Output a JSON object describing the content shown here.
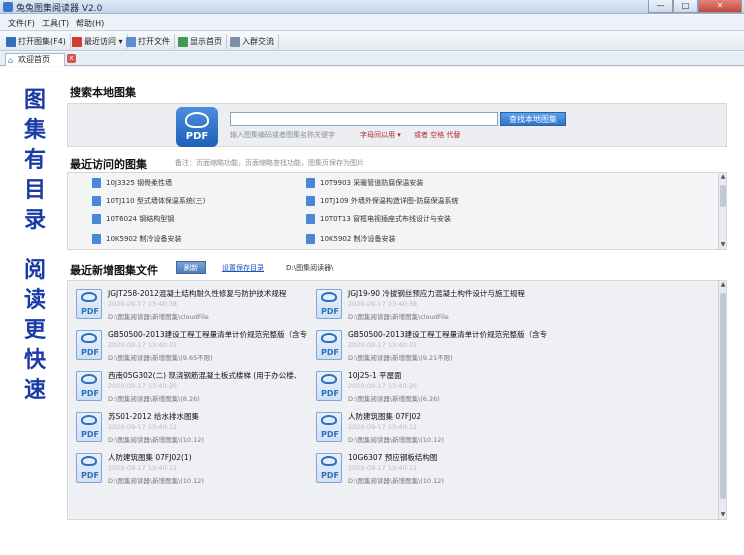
{
  "window": {
    "title": "兔兔图集阅读器 V2.0",
    "min_glyph": "—",
    "max_glyph": "□",
    "close_glyph": "✕"
  },
  "menu": [
    {
      "label": "文件(F)"
    },
    {
      "label": "工具(T)"
    },
    {
      "label": "帮助(H)"
    }
  ],
  "toolbar": {
    "open_atlas": "打开图集(F4)",
    "recent": "最近访问 ▾",
    "open_file": "打开文件",
    "show_home": "显示首页",
    "join_group": "入群交流"
  },
  "tab": {
    "label": "欢迎首页",
    "close_glyph": "x"
  },
  "slogan": [
    "图",
    "集",
    "有",
    "目",
    "录",
    "阅",
    "读",
    "更",
    "快",
    "速"
  ],
  "search": {
    "title": "搜索本地图集",
    "logo_text": "PDF",
    "input_value": "",
    "button_label": "查找本地图集",
    "hint": "输入图集编码或者图集名称关键字",
    "filter_label": "字母间以用 ▾",
    "tips": "或者 空格 代替"
  },
  "recent": {
    "title": "最近访问的图集",
    "hint": "备注：页面缩略功能，页面缩略查找功能，图集页保存为图片",
    "items": [
      {
        "label": "10J3325 钢骨柔性墙"
      },
      {
        "label": "10T9903 采暖管道防腐保温安装"
      },
      {
        "label": "10TJ110 型式墙体保温系统(三)"
      },
      {
        "label": "10TJ109 外墙外保温构造详图-防腐保温系统"
      },
      {
        "label": "10T6024 钢结构型钢"
      },
      {
        "label": "10T0T13 窗框电视插座式布线设计与安装"
      },
      {
        "label": "10K5902 制冷设备安装"
      },
      {
        "label": "10K5902 制冷设备安装"
      }
    ]
  },
  "new_files": {
    "title": "最近新增图集文件",
    "refresh_label": "刷新",
    "save_link": "设置保存目录",
    "save_path": "D:\\图集阅读器\\",
    "items": [
      {
        "title": "JGJT258-2012混凝土结构耐久性修复与防护技术规程",
        "meta": "2020-09-17 13:40:38",
        "path": "D:\\图集阅读器\\新增图集\\cloudFile"
      },
      {
        "title": "JGJ19-90 冷拔钢丝预应力混凝土构件设计与施工规程",
        "meta": "2020-09-17 13:40:38",
        "path": "D:\\图集阅读器\\新增图集\\cloudFile"
      },
      {
        "title": "GB50500-2013建设工程工程量清单计价规范完整版（含专",
        "meta": "2020-09-17 13:40:31",
        "path": "D:\\图集阅读器\\新增图集\\(9.65不限)"
      },
      {
        "title": "GB50500-2013建设工程工程量清单计价规范完整版（含专",
        "meta": "2020-09-17 13:40:31",
        "path": "D:\\图集阅读器\\新增图集\\(9.21不限)"
      },
      {
        "title": "西南05G302(二) 现浇钢筋混凝土板式楼梯 (用于办公楼、",
        "meta": "2020-09-17 13:40:26",
        "path": "D:\\图集阅读器\\新增图集\\(8.26)"
      },
      {
        "title": "10J25-1 平屋面",
        "meta": "2020-09-17 13:40:26",
        "path": "D:\\图集阅读器\\新增图集\\(6.26)"
      },
      {
        "title": "苏S01-2012 给水排水图集",
        "meta": "2020-09-17 13:40:12",
        "path": "D:\\图集阅读器\\新增图集\\(10.12)"
      },
      {
        "title": "人防建筑图集 07FJ02",
        "meta": "2020-09-17 13:40:12",
        "path": "D:\\图集阅读器\\新增图集\\(10.12)"
      },
      {
        "title": "人防建筑图集 07FJ02(1)",
        "meta": "2020-09-17 13:40:12",
        "path": "D:\\图集阅读器\\新增图集\\(10.12)"
      },
      {
        "title": "10G6307 预应钢板结构图",
        "meta": "2020-09-17 13:40:12",
        "path": "D:\\图集阅读器\\新增图集\\(10.12)"
      }
    ]
  },
  "scroll": {
    "up": "▲",
    "down": "▼"
  }
}
